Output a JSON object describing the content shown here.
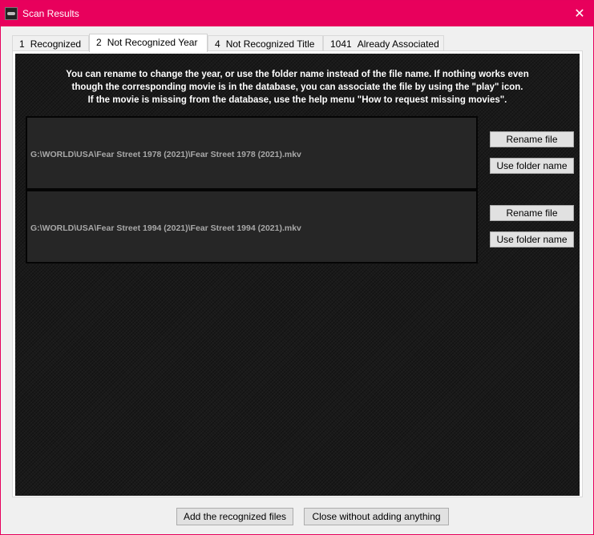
{
  "window": {
    "title": "Scan Results",
    "close_glyph": "✕"
  },
  "tabs": [
    {
      "count": "1",
      "label": "Recognized"
    },
    {
      "count": "2",
      "label": "Not Recognized Year"
    },
    {
      "count": "4",
      "label": "Not Recognized Title"
    },
    {
      "count": "1041",
      "label": "Already Associated"
    }
  ],
  "active_tab": 1,
  "info": {
    "line1": "You can rename to change the year, or use the folder name instead of the file name. If nothing works even",
    "line2": "though the corresponding movie is in the database, you can associate the file by using the \"play\" icon.",
    "line3": "If the movie is missing from the database, use the help menu \"How to request missing movies\"."
  },
  "files": [
    {
      "path": "G:\\WORLD\\USA\\Fear Street 1978 (2021)\\Fear Street 1978 (2021).mkv",
      "rename_label": "Rename file",
      "folder_label": "Use folder name"
    },
    {
      "path": "G:\\WORLD\\USA\\Fear Street 1994 (2021)\\Fear Street 1994 (2021).mkv",
      "rename_label": "Rename file",
      "folder_label": "Use folder name"
    }
  ],
  "footer": {
    "add_label": "Add the recognized files",
    "close_label": "Close without adding anything"
  },
  "colors": {
    "titlebar": "#e8005c",
    "panel_bg": "#1a1a1a",
    "row_bg": "#262626",
    "path_text": "#a8a8a8"
  },
  "icons": {
    "app": "film-projector-icon",
    "close": "close-icon"
  }
}
